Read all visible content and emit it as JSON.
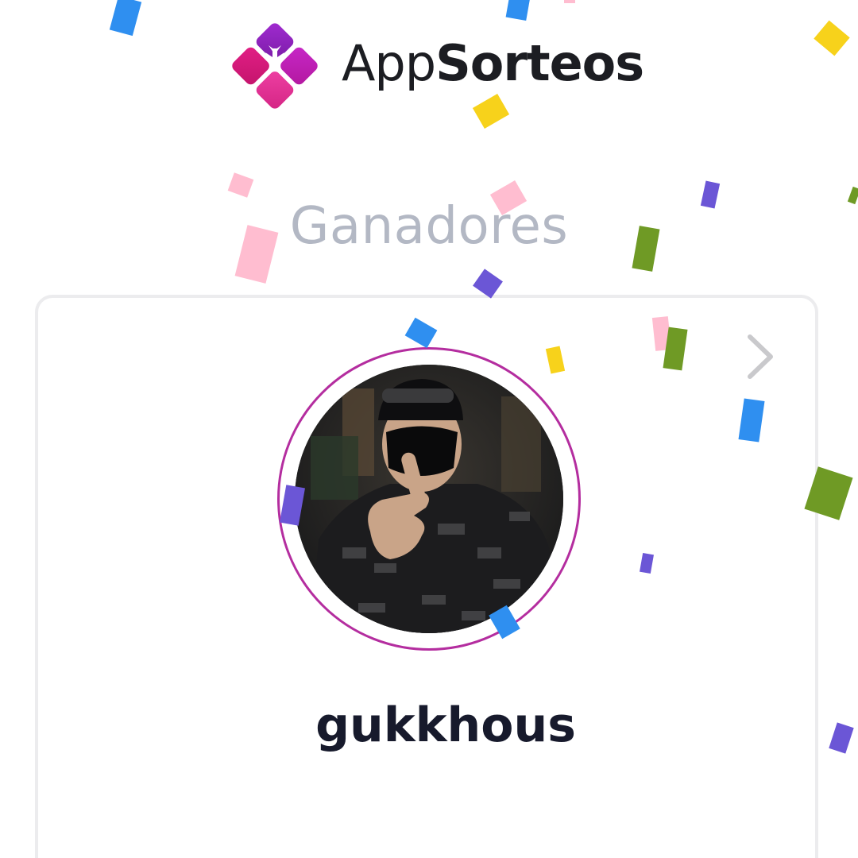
{
  "header": {
    "brand_light": "App",
    "brand_bold": "Sorteos",
    "logo_icon": "gift-box-icon",
    "logo_colors": [
      "#8e1fbf",
      "#c21db1",
      "#e0308f",
      "#d81b7a"
    ]
  },
  "section": {
    "title": "Ganadores"
  },
  "winner": {
    "username": "gukkhous",
    "next_icon": "chevron-right-icon",
    "ring_color": "#b42d9f"
  },
  "colors": {
    "title_gray": "#b3b8c4",
    "name_dark": "#171a2c",
    "card_border": "#ececee",
    "confetti": [
      "#2f8ff0",
      "#f7d21b",
      "#ffbdd0",
      "#6b56d6",
      "#6f9a25"
    ]
  }
}
